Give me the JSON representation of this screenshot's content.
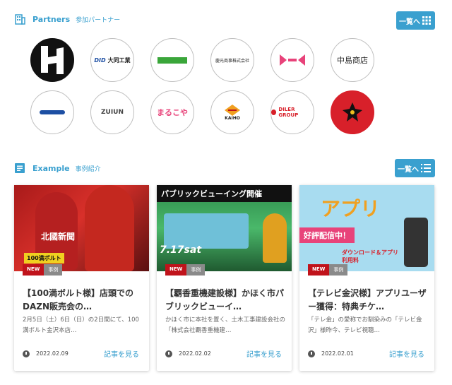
{
  "partners_section": {
    "title": "Partners",
    "subtitle": "参加パートナー",
    "list_button": "一覧へ",
    "logos": [
      {
        "name": "black-logo",
        "text": ""
      },
      {
        "name": "daido",
        "text": "大同工業"
      },
      {
        "name": "green-company",
        "text": ""
      },
      {
        "name": "kei-company",
        "text": "慶光商事株式会社"
      },
      {
        "name": "pink-clinic",
        "text": ""
      },
      {
        "name": "nakajima",
        "text": "中島商店"
      },
      {
        "name": "blue-company",
        "text": ""
      },
      {
        "name": "zuiun",
        "text": "ZUIUN"
      },
      {
        "name": "colorful-logo",
        "text": "まるこや"
      },
      {
        "name": "kaiho",
        "text": "KAIHO"
      },
      {
        "name": "diler",
        "text": "DILER GROUP"
      },
      {
        "name": "red-crest",
        "text": ""
      }
    ]
  },
  "example_section": {
    "title": "Example",
    "subtitle": "事例紹介",
    "list_button": "一覧へ"
  },
  "cards": [
    {
      "thumb_text_1": "北國新聞",
      "thumb_text_2": "100満ボルト",
      "tag_new": "NEW",
      "tag_cat": "事例",
      "title": "【100満ボルト様】店頭でのDAZN販売会の…",
      "desc": "2月5日（土）6日（日）の2日間にて、100満ボルト金沢本店…",
      "date": "2022.02.09",
      "more": "記事を見る"
    },
    {
      "thumb_text_1": "パブリックビューイング開催",
      "thumb_text_2": "7.17sat",
      "tag_new": "NEW",
      "tag_cat": "事例",
      "title": "【覇香重機建設様】かほく市パブリックビューイ…",
      "desc": "かほく市に本社を置く、土木工事建設会社の「株式会社覇香重機建…",
      "date": "2022.02.02",
      "more": "記事を見る"
    },
    {
      "thumb_text_1": "アプリ",
      "thumb_text_2": "好評配信中！",
      "thumb_text_3": "ダウンロード＆アプリ利用料",
      "tag_new": "NEW",
      "tag_cat": "事例",
      "title": "【テレビ金沢様】アプリユーザー獲得：特典チケ…",
      "desc": "「テレ金」の愛称でお馴染みの「テレビ金沢」様昨今、テレビ視聴…",
      "date": "2022.02.01",
      "more": "記事を見る"
    }
  ],
  "colors": {
    "accent": "#3aa0cf",
    "new_tag": "#c0131b",
    "category_tag": "#8a8a8a"
  }
}
